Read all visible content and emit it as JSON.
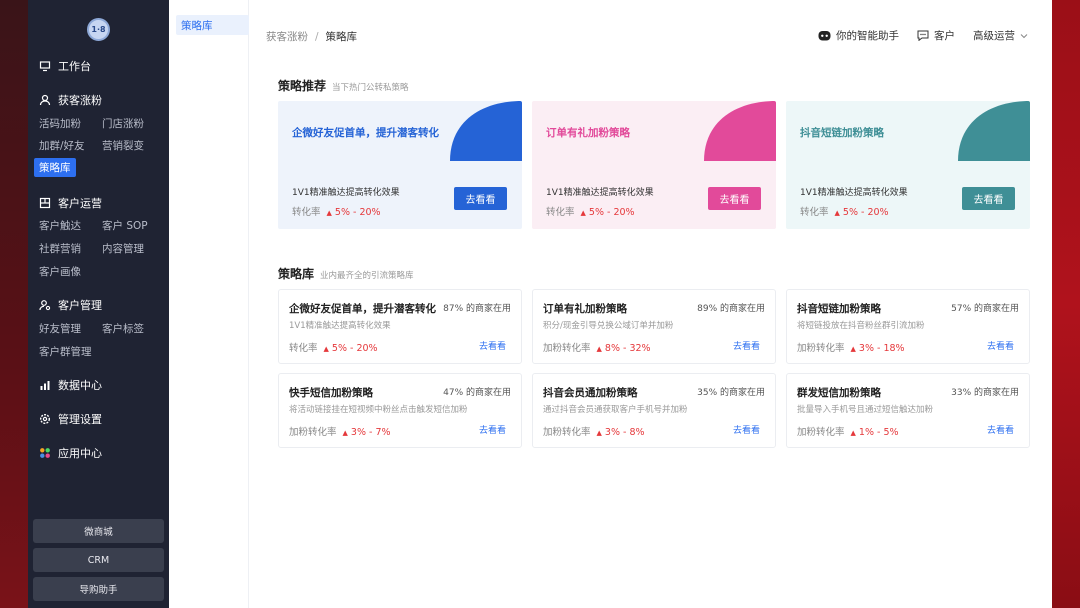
{
  "sidebar": {
    "logo_text": "1·8",
    "workbench": "工作台",
    "groups": [
      {
        "title": "获客涨粉",
        "items": [
          "活码加粉",
          "门店涨粉",
          "加群/好友",
          "营销裂变",
          "策略库"
        ]
      },
      {
        "title": "客户运营",
        "items": [
          "客户触达",
          "客户 SOP",
          "社群营销",
          "内容管理",
          "客户画像"
        ]
      },
      {
        "title": "客户管理",
        "items": [
          "好友管理",
          "客户标签",
          "客户群管理"
        ]
      }
    ],
    "data_center": "数据中心",
    "settings": "管理设置",
    "apps": "应用中心",
    "bottom_buttons": [
      "微商城",
      "CRM",
      "导购助手"
    ]
  },
  "submenu": {
    "active": "策略库"
  },
  "header": {
    "breadcrumb_parent": "获客涨粉",
    "breadcrumb_sep": "/",
    "breadcrumb_current": "策略库",
    "assistant": "你的智能助手",
    "customer": "客户",
    "ops": "高级运营"
  },
  "recommend": {
    "title": "策略推荐",
    "subtitle": "当下热门公转私策略",
    "cards": [
      {
        "title": "企微好友促首单，提升潜客转化",
        "desc": "1V1精准触达提高转化效果",
        "rate_label": "转化率",
        "rate": "5% - 20%",
        "button": "去看看",
        "accent": "#2563d6",
        "bg": "#eef3fb"
      },
      {
        "title": "订单有礼加粉策略",
        "desc": "1V1精准触达提高转化效果",
        "rate_label": "转化率",
        "rate": "5% - 20%",
        "button": "去看看",
        "accent": "#e24a9a",
        "bg": "#fbeef4"
      },
      {
        "title": "抖音短链加粉策略",
        "desc": "1V1精准触达提高转化效果",
        "rate_label": "转化率",
        "rate": "5% - 20%",
        "button": "去看看",
        "accent": "#3f8f96",
        "bg": "#edf7f8"
      }
    ]
  },
  "library": {
    "title": "策略库",
    "subtitle": "业内最齐全的引流策略库",
    "cards": [
      {
        "title": "企微好友促首单，提升潜客转化",
        "usage": "87% 的商家在用",
        "desc": "1V1精准触达提高转化效果",
        "rate_label": "转化率",
        "rate": "5% - 20%",
        "link": "去看看"
      },
      {
        "title": "订单有礼加粉策略",
        "usage": "89% 的商家在用",
        "desc": "积分/现金引导兑换公域订单并加粉",
        "rate_label": "加粉转化率",
        "rate": "8% - 32%",
        "link": "去看看"
      },
      {
        "title": "抖音短链加粉策略",
        "usage": "57% 的商家在用",
        "desc": "将短链投放在抖音粉丝群引流加粉",
        "rate_label": "加粉转化率",
        "rate": "3% - 18%",
        "link": "去看看"
      },
      {
        "title": "快手短信加粉策略",
        "usage": "47% 的商家在用",
        "desc": "将活动链接挂在短视频中粉丝点击触发短信加粉",
        "rate_label": "加粉转化率",
        "rate": "3% - 7%",
        "link": "去看看"
      },
      {
        "title": "抖音会员通加粉策略",
        "usage": "35% 的商家在用",
        "desc": "通过抖音会员通获取客户手机号并加粉",
        "rate_label": "加粉转化率",
        "rate": "3% - 8%",
        "link": "去看看"
      },
      {
        "title": "群发短信加粉策略",
        "usage": "33% 的商家在用",
        "desc": "批量导入手机号且通过短信触达加粉",
        "rate_label": "加粉转化率",
        "rate": "1% - 5%",
        "link": "去看看"
      }
    ]
  }
}
